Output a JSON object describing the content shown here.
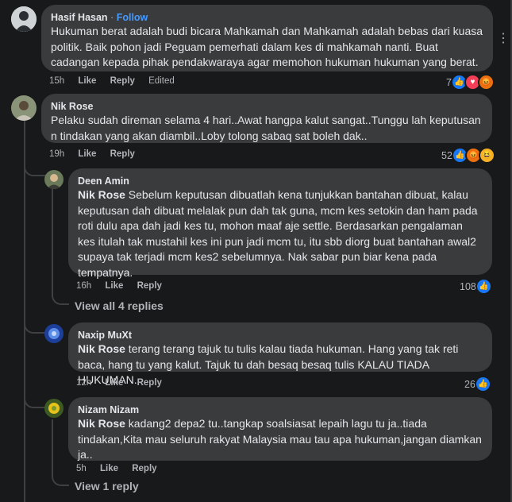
{
  "comments": [
    {
      "name": "Hasif Hasan",
      "follow": "Follow",
      "text": "Hukuman berat adalah budi bicara Mahkamah dan Mahkamah adalah bebas dari kuasa politik. Baik pohon jadi Peguam pemerhati dalam kes di mahkamah nanti. Buat cadangan kepada pihak pendakwaraya agar memohon hukuman hukuman yang berat.",
      "time": "15h",
      "like": "Like",
      "reply": "Reply",
      "edited": "Edited",
      "reaction_count": "7",
      "reactions": [
        "like-icon",
        "love-icon",
        "angry-icon"
      ]
    },
    {
      "name": "Nik Rose",
      "text": "Pelaku sudah direman selama 4 hari..Awat hangpa kalut sangat..Tunggu lah keputusan n tindakan yang akan diambil..Loby tolong sabaq sat boleh dak..",
      "time": "19h",
      "like": "Like",
      "reply": "Reply",
      "reaction_count": "52",
      "reactions": [
        "like-icon",
        "angry-icon",
        "haha-icon"
      ]
    }
  ],
  "replies": [
    {
      "name": "Deen Amin",
      "mention": "Nik Rose",
      "text": " Sebelum keputusan dibuatlah kena tunjukkan bantahan dibuat, kalau keputusan dah dibuat melalak pun dah tak guna, mcm kes setokin dan ham pada roti dulu apa dah jadi kes tu, mohon maaf aje settle. Berdasarkan pengalaman kes itulah tak mustahil kes ini pun jadi mcm tu, itu sbb diorg buat bantahan awal2 supaya tak terjadi mcm kes2 sebelumnya. Nak sabar pun biar kena pada tempatnya.",
      "time": "16h",
      "like": "Like",
      "reply": "Reply",
      "reaction_count": "108",
      "reactions": [
        "like-icon"
      ]
    },
    {
      "name": "Naxip MuXt",
      "mention": "Nik Rose",
      "text": " terang terang tajuk tu tulis kalau tiada hukuman. Hang yang tak reti baca, hang tu yang kalut. Tajuk tu dah besaq besaq tulis KALAU TIADA HUKUMAN.",
      "time": "12h",
      "like": "Like",
      "reply": "Reply",
      "reaction_count": "26",
      "reactions": [
        "like-icon"
      ]
    },
    {
      "name": "Nizam Nizam",
      "mention": "Nik Rose",
      "text": " kadang2 depa2 tu..tangkap soalsiasat lepaih lagu tu ja..tiada tindakan,Kita mau seluruh rakyat Malaysia mau tau apa hukuman,jangan diamkan ja..",
      "time": "5h",
      "like": "Like",
      "reply": "Reply"
    }
  ],
  "view_all_replies": "View all 4 replies",
  "view_one_reply": "View 1 reply",
  "more_options": "⋮"
}
